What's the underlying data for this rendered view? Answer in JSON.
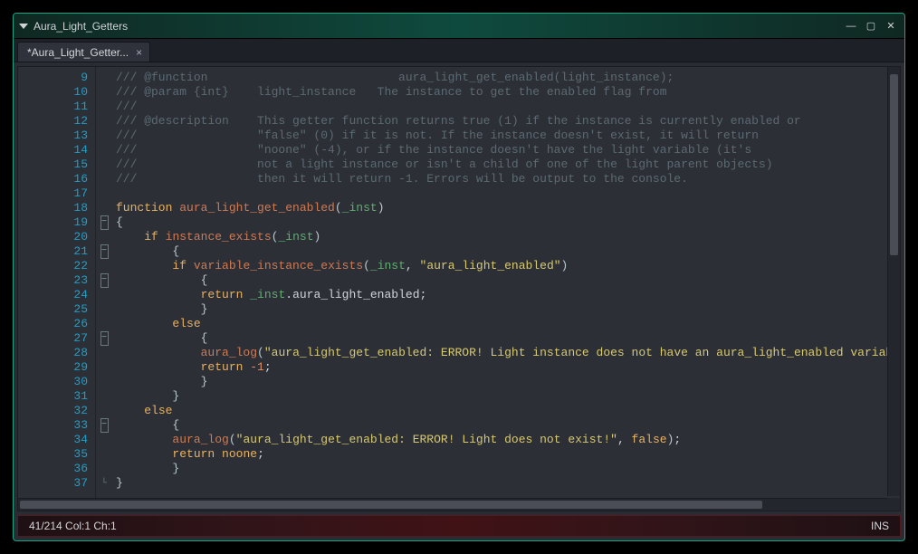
{
  "window": {
    "title": "Aura_Light_Getters"
  },
  "tab": {
    "label": "*Aura_Light_Getter..."
  },
  "status": {
    "pos": "41/214 Col:1 Ch:1",
    "mode": "INS"
  },
  "line_start": 9,
  "line_count": 29,
  "code": {
    "lines": [
      {
        "type": "comment",
        "text": "/// @function                           aura_light_get_enabled(light_instance);"
      },
      {
        "type": "comment",
        "text": "/// @param {int}    light_instance   The instance to get the enabled flag from"
      },
      {
        "type": "comment",
        "text": "///"
      },
      {
        "type": "comment",
        "text": "/// @description    This getter function returns true (1) if the instance is currently enabled or"
      },
      {
        "type": "comment",
        "text": "///                 \"false\" (0) if it is not. If the instance doesn't exist, it will return"
      },
      {
        "type": "comment",
        "text": "///                 \"noone\" (-4), or if the instance doesn't have the light variable (it's"
      },
      {
        "type": "comment",
        "text": "///                 not a light instance or isn't a child of one of the light parent objects)"
      },
      {
        "type": "comment",
        "text": "///                 then it will return -1. Errors will be output to the console."
      },
      {
        "type": "blank",
        "text": ""
      },
      {
        "type": "funcdef",
        "kw": "function",
        "name": "aura_light_get_enabled",
        "arg": "_inst"
      },
      {
        "type": "brace",
        "text": "{",
        "fold": true,
        "indent": 0
      },
      {
        "type": "if",
        "kw": "if",
        "call": "instance_exists",
        "arg": "_inst",
        "indent": 1
      },
      {
        "type": "brace",
        "text": "{",
        "fold": true,
        "indent": 2
      },
      {
        "type": "if2",
        "kw": "if",
        "call": "variable_instance_exists",
        "arg": "_inst",
        "str": "\"aura_light_enabled\"",
        "indent": 2
      },
      {
        "type": "brace",
        "text": "{",
        "fold": true,
        "indent": 3
      },
      {
        "type": "return_expr",
        "kw": "return",
        "arg": "_inst",
        "tail": ".aura_light_enabled;",
        "indent": 3
      },
      {
        "type": "brace",
        "text": "}",
        "indent": 3
      },
      {
        "type": "else",
        "kw": "else",
        "indent": 2
      },
      {
        "type": "brace",
        "text": "{",
        "fold": true,
        "indent": 3
      },
      {
        "type": "log",
        "call": "aura_log",
        "str": "\"aura_light_get_enabled: ERROR! Light instance does not have an aura_light_enabled variable!\"",
        "bool": "false",
        "indent": 3
      },
      {
        "type": "return_num",
        "kw": "return",
        "num": "-1",
        "indent": 3
      },
      {
        "type": "brace",
        "text": "}",
        "indent": 3
      },
      {
        "type": "brace",
        "text": "}",
        "indent": 2
      },
      {
        "type": "else",
        "kw": "else",
        "indent": 1
      },
      {
        "type": "brace",
        "text": "{",
        "fold": true,
        "indent": 2
      },
      {
        "type": "log",
        "call": "aura_log",
        "str": "\"aura_light_get_enabled: ERROR! Light does not exist!\"",
        "bool": "false",
        "indent": 2
      },
      {
        "type": "return_kw",
        "kw": "return",
        "kw2": "noone",
        "indent": 2
      },
      {
        "type": "brace",
        "text": "}",
        "indent": 2
      },
      {
        "type": "brace",
        "text": "}",
        "fold_end": true,
        "indent": 0
      }
    ]
  }
}
